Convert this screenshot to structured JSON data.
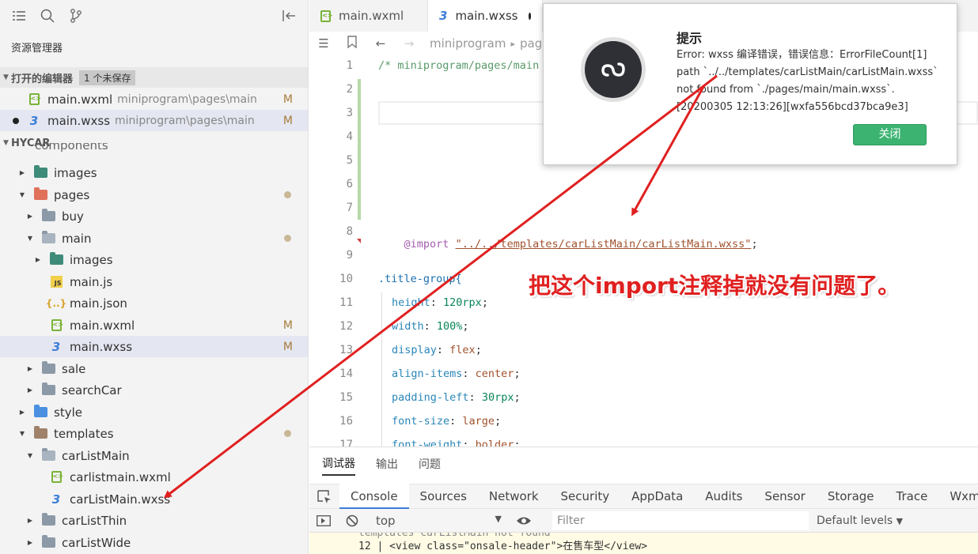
{
  "sidebar": {
    "explorer_title": "资源管理器",
    "open_editors": {
      "label": "打开的编辑器",
      "badge": "1 个未保存"
    },
    "open_files": [
      {
        "name": "main.wxml",
        "path": "miniprogram\\pages\\main",
        "status": "M"
      },
      {
        "name": "main.wxss",
        "path": "miniprogram\\pages\\main",
        "status": "M"
      }
    ],
    "project_label": "HYCAR",
    "tree": {
      "components": "components",
      "images": "images",
      "pages": "pages",
      "buy": "buy",
      "main": "main",
      "main_images": "images",
      "main_js": "main.js",
      "main_json": "main.json",
      "main_wxml": "main.wxml",
      "main_wxss": "main.wxss",
      "status_m": "M",
      "sale": "sale",
      "searchCar": "searchCar",
      "style": "style",
      "templates": "templates",
      "carListMain": "carListMain",
      "carlistmain_wxml": "carlistmain.wxml",
      "carListMain_wxss": "carListMain.wxss",
      "carListThin": "carListThin",
      "carListWide": "carListWide"
    }
  },
  "tabs": [
    {
      "label": "main.wxml"
    },
    {
      "label": "main.wxss"
    }
  ],
  "breadcrumb": {
    "seg1": "miniprogram",
    "sep": "▸",
    "seg2": "pag"
  },
  "code": {
    "line_numbers": [
      "1",
      "2",
      "3",
      "4",
      "5",
      "6",
      "7",
      "8",
      "9",
      "10",
      "11",
      "12",
      "13",
      "14",
      "15",
      "16",
      "17"
    ],
    "l1": "/* miniprogram/pages/main",
    "l8_kw": "@import",
    "l8_str": "\"../../templates/carListMain/carListMain.wxss\"",
    "l8_end": ";",
    "l10": ".title-group{",
    "l11_p": "height",
    "l11_v": "120rpx",
    "l12_p": "width",
    "l12_v": "100%",
    "l13_p": "display",
    "l13_v": "flex",
    "l14_p": "align-items",
    "l14_v": "center",
    "l15_p": "padding-left",
    "l15_v": "30rpx",
    "l16_p": "font-size",
    "l16_v": "large",
    "l17_p": "font-weight",
    "l17_v": "bolder"
  },
  "panel": {
    "tabs": [
      "调试器",
      "输出",
      "问题"
    ],
    "devtools_tabs": [
      "Console",
      "Sources",
      "Network",
      "Security",
      "AppData",
      "Audits",
      "Sensor",
      "Storage",
      "Trace",
      "Wxml"
    ],
    "context": "top",
    "filter_placeholder": "Filter",
    "levels": "Default levels",
    "log_line1": "templates  carListMain  not found",
    "log_line2": "12 |  <view class=\"onsale-header\">在售车型</view>"
  },
  "dialog": {
    "title": "提示",
    "message_lines": [
      "Error: wxss 编译错误，错误信息：ErrorFileCount[1]",
      "path `../../templates/carListMain/carListMain.wxss`",
      "not found from `./pages/main/main.wxss`.",
      "[20200305 12:13:26][wxfa556bcd37bca9e3]"
    ],
    "close_button": "关闭",
    "button_color": "#3cb371"
  },
  "annotation": {
    "text": "把这个import注释掉就没有问题了。",
    "color": "#e02020"
  }
}
